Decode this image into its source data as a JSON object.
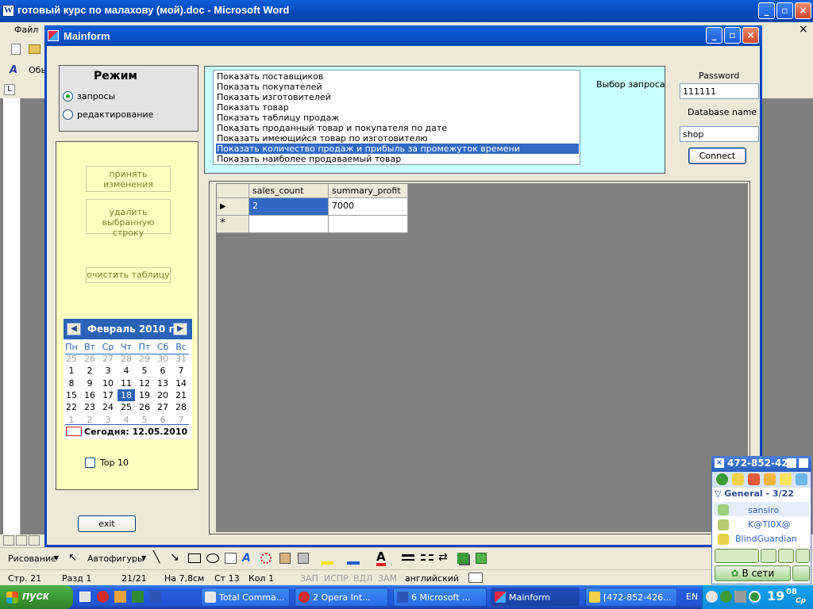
{
  "word": {
    "title": "готовый курс по малахову (мой).doc - Microsoft Word",
    "menu_file": "Файл",
    "style_label": "Обы",
    "draw_label": "Рисование",
    "autoshapes_label": "Автофигуры",
    "status": {
      "page": "Стр. 21",
      "section": "Разд 1",
      "pages": "21/21",
      "position": "На 7,8см",
      "line": "Ст 13",
      "col": "Кол 1",
      "rec": "ЗАП",
      "trk": "ИСПР",
      "ext": "ВДЛ",
      "ovr": "ЗАМ",
      "language": "английский"
    },
    "close_doc": "×"
  },
  "mainform": {
    "title": "Mainform",
    "mode": {
      "title": "Режим",
      "options": [
        {
          "label": "запросы",
          "selected": true
        },
        {
          "label": "редактирование",
          "selected": false
        }
      ]
    },
    "buttons": {
      "accept_l1": "принять",
      "accept_l2": "изменения",
      "delete_l1": "удалить",
      "delete_l2": "выбранную строку",
      "clear": "очистить таблицу",
      "exit": "exit",
      "connect": "Connect"
    },
    "calendar": {
      "month": "Февраль 2010 г.",
      "prev": "<",
      "next": ">",
      "dow": [
        "Пн",
        "Вт",
        "Ср",
        "Чт",
        "Пт",
        "Сб",
        "Вс"
      ],
      "weeks": [
        [
          "25",
          "26",
          "27",
          "28",
          "29",
          "30",
          "31"
        ],
        [
          "1",
          "2",
          "3",
          "4",
          "5",
          "6",
          "7"
        ],
        [
          "8",
          "9",
          "10",
          "11",
          "12",
          "13",
          "14"
        ],
        [
          "15",
          "16",
          "17",
          "18",
          "19",
          "20",
          "21"
        ],
        [
          "22",
          "23",
          "24",
          "25",
          "26",
          "27",
          "28"
        ],
        [
          "1",
          "2",
          "3",
          "4",
          "5",
          "6",
          "7"
        ]
      ],
      "selected_day": "18",
      "today": "Сегодня: 12.05.2010"
    },
    "top10": {
      "label": "Top 10",
      "checked": false
    },
    "query": {
      "label": "Выбор запроса",
      "items": [
        "Показать поставщиков",
        "Показать покупателей",
        "Показать изготовителей",
        "Показать товар",
        "Показать таблицу продаж",
        "Показать проданный товар и покупателя по дате",
        "Показать имеющийся товар по изготовителю",
        "Показать количество продаж и прибыль за промежуток времени",
        "Показать наиболее продаваемый товар"
      ],
      "selected_index": 7
    },
    "connection": {
      "password_label": "Password",
      "password_value": "111111",
      "db_label": "Database name",
      "db_value": "shop"
    },
    "grid": {
      "columns": [
        "sales_count",
        "summary_profit"
      ],
      "rows": [
        [
          "2",
          "7000"
        ]
      ],
      "new_row_marker": "*",
      "current_row_marker": "▶"
    }
  },
  "icq": {
    "uin": "472-852-426",
    "group": "General - 3/22",
    "contacts": [
      "sansiro",
      "K@TI0X@",
      "BlindGuardian"
    ],
    "status": "В сети"
  },
  "taskbar": {
    "start": "пуск",
    "tasks": [
      "Total Comma...",
      "2 Opera Int...",
      "6 Microsoft ...",
      "Mainform",
      "[472-852-426..."
    ],
    "active_task": "Mainform",
    "lang": "EN",
    "clock_hour": "19",
    "clock_min": "08",
    "clock_day": "Ср"
  },
  "colors": {
    "xp_blue": "#0a5fd8",
    "selection": "#316ac5",
    "query_panel": "#c8ffff",
    "yellow_panel": "#ffffc0",
    "grid_bg": "#808080"
  }
}
